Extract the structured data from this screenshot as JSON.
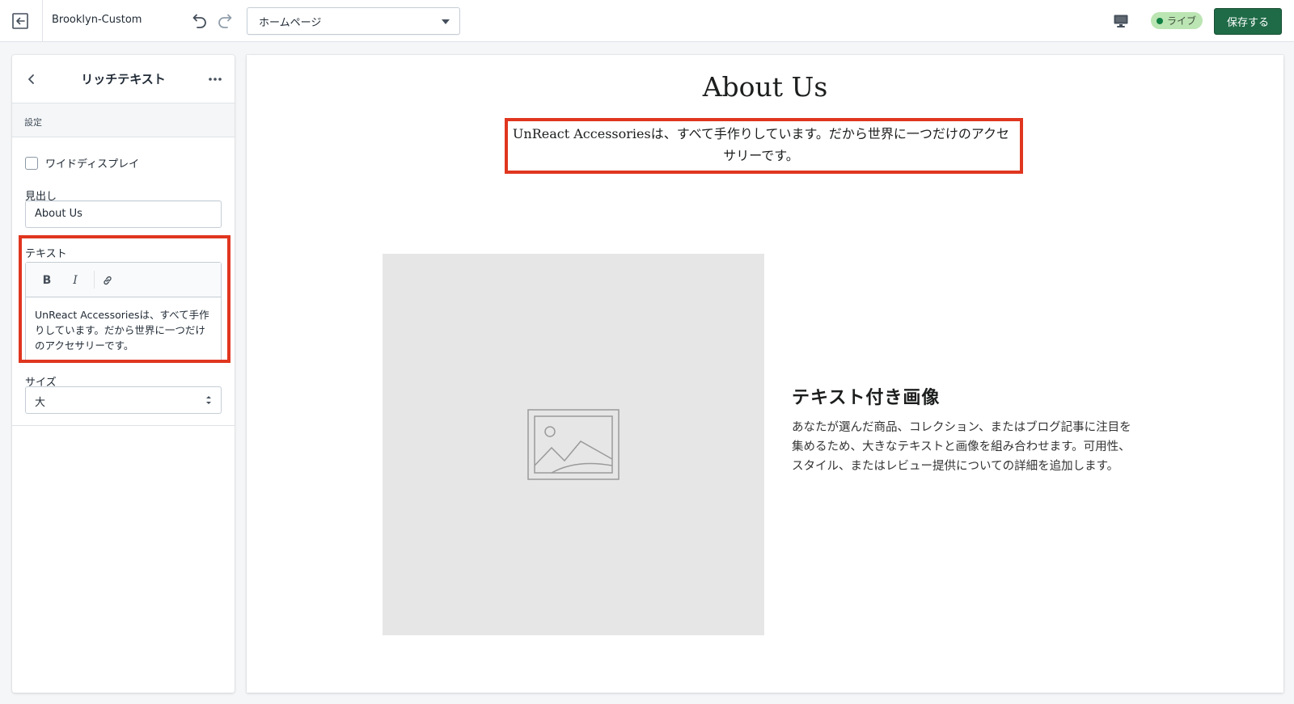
{
  "topbar": {
    "theme_name": "Brooklyn-Custom",
    "page_select_value": "ホームページ",
    "live_label": "ライブ",
    "save_label": "保存する"
  },
  "sidebar": {
    "title": "リッチテキスト",
    "section_label": "設定",
    "wide_display_label": "ワイドディスプレイ",
    "heading_label": "見出し",
    "heading_value": "About Us",
    "text_label": "テキスト",
    "text_toolbar": {
      "bold": "B",
      "italic": "I"
    },
    "text_value": "UnReact Accessoriesは、すべて手作りしています。だから世界に一つだけのアクセサリーです。",
    "size_label": "サイズ",
    "size_value": "大"
  },
  "preview": {
    "heading": "About Us",
    "richtext": "UnReact Accessoriesは、すべて手作りしています。だから世界に一つだけのアクセサリーです。",
    "image_with_text": {
      "title": "テキスト付き画像",
      "body": "あなたが選んだ商品、コレクション、またはブログ記事に注目を集めるため、大きなテキストと画像を組み合わせます。可用性、スタイル、またはレビュー提供についての詳細を追加します。"
    }
  },
  "colors": {
    "accent_save": "#1f6b47",
    "live_badge": "#bbe5b3",
    "highlight_border": "#e0361f",
    "placeholder_bg": "#e6e6e6"
  }
}
